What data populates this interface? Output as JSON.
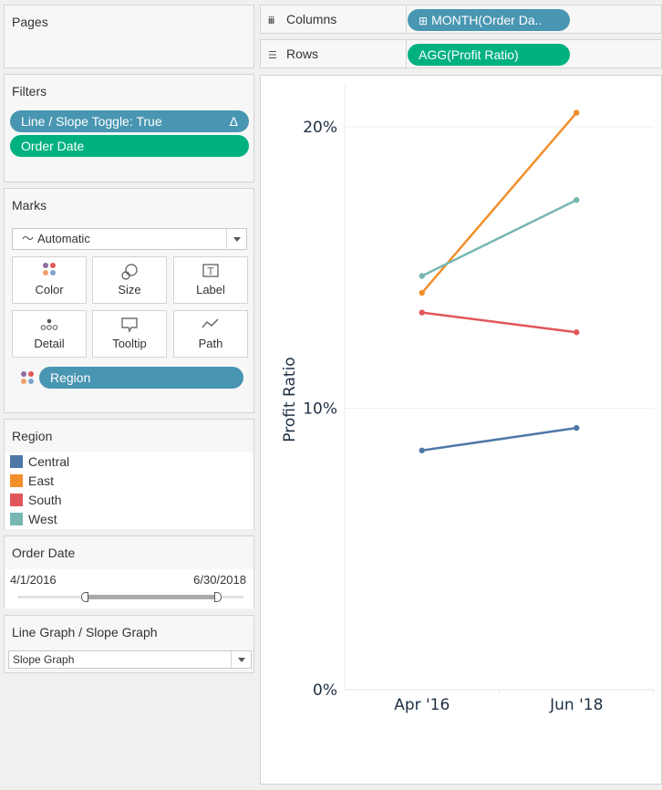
{
  "pages": {
    "title": "Pages"
  },
  "filters": {
    "title": "Filters",
    "pills": [
      {
        "label": "Line / Slope Toggle: True",
        "badge": "Δ",
        "color": "#4996b2"
      },
      {
        "label": "Order Date",
        "color": "#00b180"
      }
    ]
  },
  "shelves": {
    "columns": {
      "label": "Columns",
      "icon": "columns-icon",
      "pill": "MONTH(Order Da..",
      "pill_icon": "⊞"
    },
    "rows": {
      "label": "Rows",
      "icon": "rows-icon",
      "pill": "AGG(Profit Ratio)"
    }
  },
  "marks": {
    "title": "Marks",
    "type": "Automatic",
    "buttons": [
      {
        "label": "Color",
        "icon": "color-icon"
      },
      {
        "label": "Size",
        "icon": "size-icon"
      },
      {
        "label": "Label",
        "icon": "label-icon"
      },
      {
        "label": "Detail",
        "icon": "detail-icon"
      },
      {
        "label": "Tooltip",
        "icon": "tooltip-icon"
      },
      {
        "label": "Path",
        "icon": "path-icon"
      }
    ],
    "field_pill": "Region"
  },
  "legend": {
    "title": "Region",
    "items": [
      {
        "label": "Central",
        "color": "#4e79a7"
      },
      {
        "label": "East",
        "color": "#f28e2b"
      },
      {
        "label": "South",
        "color": "#e15759"
      },
      {
        "label": "West",
        "color": "#76b7b2"
      }
    ]
  },
  "order_date_filter": {
    "title": "Order Date",
    "start": "4/1/2016",
    "end": "6/30/2018",
    "range_fraction": [
      0.3,
      0.89
    ]
  },
  "graph_toggle": {
    "title": "Line Graph / Slope Graph",
    "selected": "Slope Graph"
  },
  "chart_data": {
    "type": "line",
    "title": "",
    "xlabel": "",
    "ylabel": "Profit Ratio",
    "categories": [
      "Apr '16",
      "Jun '18"
    ],
    "y_ticks": [
      "0%",
      "10%",
      "20%"
    ],
    "ylim": [
      0,
      21.5
    ],
    "grid": true,
    "series": [
      {
        "name": "Central",
        "color": "#4e79a7",
        "values": [
          8.5,
          9.3
        ]
      },
      {
        "name": "East",
        "color": "#f28e2b",
        "values": [
          14.1,
          20.5
        ]
      },
      {
        "name": "South",
        "color": "#e15759",
        "values": [
          13.4,
          12.7
        ]
      },
      {
        "name": "West",
        "color": "#76b7b2",
        "values": [
          14.7,
          17.4
        ]
      }
    ]
  }
}
